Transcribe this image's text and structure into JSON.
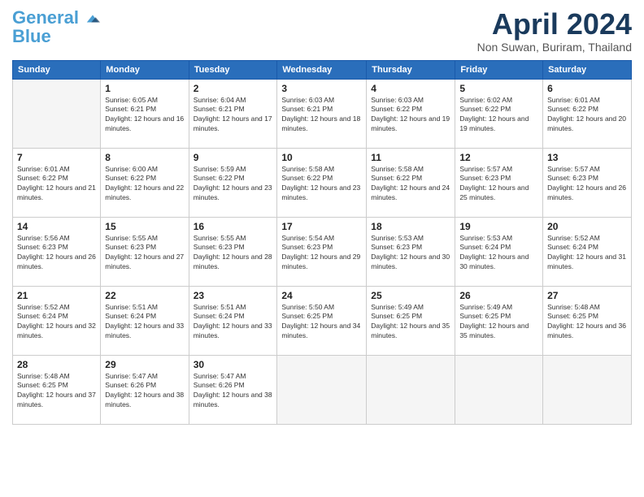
{
  "logo": {
    "line1": "General",
    "line2": "Blue"
  },
  "title": "April 2024",
  "location": "Non Suwan, Buriram, Thailand",
  "weekdays": [
    "Sunday",
    "Monday",
    "Tuesday",
    "Wednesday",
    "Thursday",
    "Friday",
    "Saturday"
  ],
  "weeks": [
    [
      {
        "day": "",
        "sunrise": "",
        "sunset": "",
        "daylight": ""
      },
      {
        "day": "1",
        "sunrise": "Sunrise: 6:05 AM",
        "sunset": "Sunset: 6:21 PM",
        "daylight": "Daylight: 12 hours and 16 minutes."
      },
      {
        "day": "2",
        "sunrise": "Sunrise: 6:04 AM",
        "sunset": "Sunset: 6:21 PM",
        "daylight": "Daylight: 12 hours and 17 minutes."
      },
      {
        "day": "3",
        "sunrise": "Sunrise: 6:03 AM",
        "sunset": "Sunset: 6:21 PM",
        "daylight": "Daylight: 12 hours and 18 minutes."
      },
      {
        "day": "4",
        "sunrise": "Sunrise: 6:03 AM",
        "sunset": "Sunset: 6:22 PM",
        "daylight": "Daylight: 12 hours and 19 minutes."
      },
      {
        "day": "5",
        "sunrise": "Sunrise: 6:02 AM",
        "sunset": "Sunset: 6:22 PM",
        "daylight": "Daylight: 12 hours and 19 minutes."
      },
      {
        "day": "6",
        "sunrise": "Sunrise: 6:01 AM",
        "sunset": "Sunset: 6:22 PM",
        "daylight": "Daylight: 12 hours and 20 minutes."
      }
    ],
    [
      {
        "day": "7",
        "sunrise": "Sunrise: 6:01 AM",
        "sunset": "Sunset: 6:22 PM",
        "daylight": "Daylight: 12 hours and 21 minutes."
      },
      {
        "day": "8",
        "sunrise": "Sunrise: 6:00 AM",
        "sunset": "Sunset: 6:22 PM",
        "daylight": "Daylight: 12 hours and 22 minutes."
      },
      {
        "day": "9",
        "sunrise": "Sunrise: 5:59 AM",
        "sunset": "Sunset: 6:22 PM",
        "daylight": "Daylight: 12 hours and 23 minutes."
      },
      {
        "day": "10",
        "sunrise": "Sunrise: 5:58 AM",
        "sunset": "Sunset: 6:22 PM",
        "daylight": "Daylight: 12 hours and 23 minutes."
      },
      {
        "day": "11",
        "sunrise": "Sunrise: 5:58 AM",
        "sunset": "Sunset: 6:22 PM",
        "daylight": "Daylight: 12 hours and 24 minutes."
      },
      {
        "day": "12",
        "sunrise": "Sunrise: 5:57 AM",
        "sunset": "Sunset: 6:23 PM",
        "daylight": "Daylight: 12 hours and 25 minutes."
      },
      {
        "day": "13",
        "sunrise": "Sunrise: 5:57 AM",
        "sunset": "Sunset: 6:23 PM",
        "daylight": "Daylight: 12 hours and 26 minutes."
      }
    ],
    [
      {
        "day": "14",
        "sunrise": "Sunrise: 5:56 AM",
        "sunset": "Sunset: 6:23 PM",
        "daylight": "Daylight: 12 hours and 26 minutes."
      },
      {
        "day": "15",
        "sunrise": "Sunrise: 5:55 AM",
        "sunset": "Sunset: 6:23 PM",
        "daylight": "Daylight: 12 hours and 27 minutes."
      },
      {
        "day": "16",
        "sunrise": "Sunrise: 5:55 AM",
        "sunset": "Sunset: 6:23 PM",
        "daylight": "Daylight: 12 hours and 28 minutes."
      },
      {
        "day": "17",
        "sunrise": "Sunrise: 5:54 AM",
        "sunset": "Sunset: 6:23 PM",
        "daylight": "Daylight: 12 hours and 29 minutes."
      },
      {
        "day": "18",
        "sunrise": "Sunrise: 5:53 AM",
        "sunset": "Sunset: 6:23 PM",
        "daylight": "Daylight: 12 hours and 30 minutes."
      },
      {
        "day": "19",
        "sunrise": "Sunrise: 5:53 AM",
        "sunset": "Sunset: 6:24 PM",
        "daylight": "Daylight: 12 hours and 30 minutes."
      },
      {
        "day": "20",
        "sunrise": "Sunrise: 5:52 AM",
        "sunset": "Sunset: 6:24 PM",
        "daylight": "Daylight: 12 hours and 31 minutes."
      }
    ],
    [
      {
        "day": "21",
        "sunrise": "Sunrise: 5:52 AM",
        "sunset": "Sunset: 6:24 PM",
        "daylight": "Daylight: 12 hours and 32 minutes."
      },
      {
        "day": "22",
        "sunrise": "Sunrise: 5:51 AM",
        "sunset": "Sunset: 6:24 PM",
        "daylight": "Daylight: 12 hours and 33 minutes."
      },
      {
        "day": "23",
        "sunrise": "Sunrise: 5:51 AM",
        "sunset": "Sunset: 6:24 PM",
        "daylight": "Daylight: 12 hours and 33 minutes."
      },
      {
        "day": "24",
        "sunrise": "Sunrise: 5:50 AM",
        "sunset": "Sunset: 6:25 PM",
        "daylight": "Daylight: 12 hours and 34 minutes."
      },
      {
        "day": "25",
        "sunrise": "Sunrise: 5:49 AM",
        "sunset": "Sunset: 6:25 PM",
        "daylight": "Daylight: 12 hours and 35 minutes."
      },
      {
        "day": "26",
        "sunrise": "Sunrise: 5:49 AM",
        "sunset": "Sunset: 6:25 PM",
        "daylight": "Daylight: 12 hours and 35 minutes."
      },
      {
        "day": "27",
        "sunrise": "Sunrise: 5:48 AM",
        "sunset": "Sunset: 6:25 PM",
        "daylight": "Daylight: 12 hours and 36 minutes."
      }
    ],
    [
      {
        "day": "28",
        "sunrise": "Sunrise: 5:48 AM",
        "sunset": "Sunset: 6:25 PM",
        "daylight": "Daylight: 12 hours and 37 minutes."
      },
      {
        "day": "29",
        "sunrise": "Sunrise: 5:47 AM",
        "sunset": "Sunset: 6:26 PM",
        "daylight": "Daylight: 12 hours and 38 minutes."
      },
      {
        "day": "30",
        "sunrise": "Sunrise: 5:47 AM",
        "sunset": "Sunset: 6:26 PM",
        "daylight": "Daylight: 12 hours and 38 minutes."
      },
      {
        "day": "",
        "sunrise": "",
        "sunset": "",
        "daylight": ""
      },
      {
        "day": "",
        "sunrise": "",
        "sunset": "",
        "daylight": ""
      },
      {
        "day": "",
        "sunrise": "",
        "sunset": "",
        "daylight": ""
      },
      {
        "day": "",
        "sunrise": "",
        "sunset": "",
        "daylight": ""
      }
    ]
  ]
}
